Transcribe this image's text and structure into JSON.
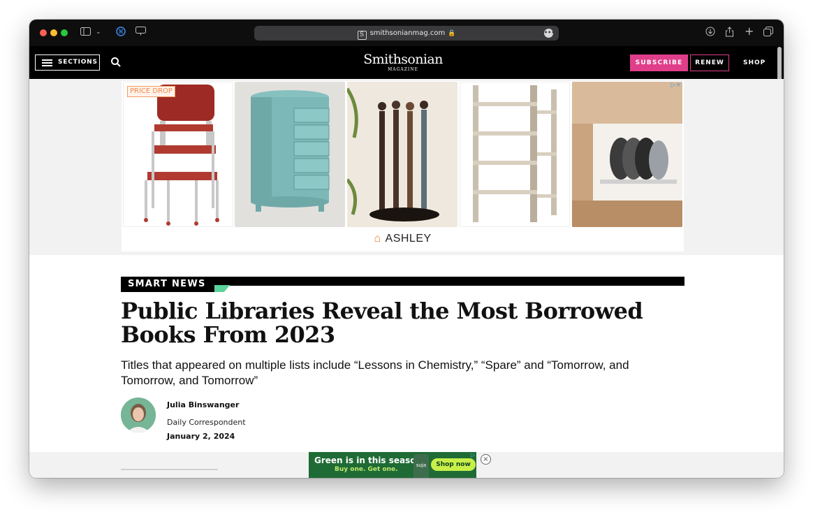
{
  "browser": {
    "url": "smithsonianmag.com",
    "favicon_letter": "S",
    "lock_glyph": "🔒",
    "more_glyph": "•••",
    "icons": [
      "sidebar-icon",
      "chevron-down-icon",
      "extension-icon",
      "password-icon",
      "download-icon",
      "share-icon",
      "new-tab-icon",
      "tab-overview-icon"
    ]
  },
  "site_header": {
    "sections_label": "SECTIONS",
    "logo_line1": "Smithsonian",
    "logo_line2": "MAGAZINE",
    "subscribe_label": "SUBSCRIBE",
    "renew_label": "RENEW",
    "shop_label": "SHOP",
    "accent_color": "#e03e8a"
  },
  "advert": {
    "badge": "PRICE DROP",
    "brand": "ASHLEY",
    "adchoices": "▷×",
    "products": [
      "step-stool",
      "jewelry-armoire",
      "figurines",
      "corner-shelving",
      "pot-lid-organizer"
    ]
  },
  "article": {
    "section_label": "SMART NEWS",
    "label_accent": "#5bd39a",
    "title": "Public Libraries Reveal the Most Borrowed Books From 2023",
    "dek": "Titles that appeared on multiple lists include “Lessons in Chemistry,” “Spare” and “Tomorrow, and Tomorrow, and Tomorrow”",
    "author": "Julia Binswanger",
    "author_role": "Daily Correspondent",
    "date": "January 2, 2024"
  },
  "sticky_ad": {
    "headline": "Green is in this season.",
    "subline": "Buy one. Get one.",
    "bottle_label": "suja",
    "cta": "Shop now",
    "close_glyph": "×",
    "adchoices": "▷"
  }
}
